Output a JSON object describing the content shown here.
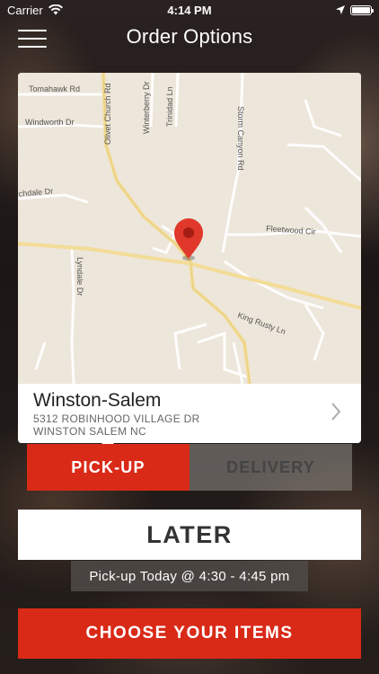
{
  "status_bar": {
    "carrier": "Carrier",
    "time": "4:14 PM",
    "battery_level": 1.0,
    "icons": [
      "wifi-icon",
      "location-arrow-icon",
      "battery-icon"
    ]
  },
  "nav": {
    "title": "Order Options",
    "menu_icon": "hamburger-menu-icon"
  },
  "map": {
    "roads": [
      "Tomahawk Rd",
      "Windworth Dr",
      "Olivet Church Rd",
      "Winterberry Dr",
      "Trinidad Ln",
      "Storm Canyon Rd",
      "rchdale Dr",
      "Fleetwood Cir",
      "Lyndale Dr",
      "King Rusty Ln"
    ],
    "pin_icon": "map-pin-icon"
  },
  "location": {
    "name": "Winston-Salem",
    "address_line1": "5312 ROBINHOOD VILLAGE DR",
    "address_line2": "WINSTON SALEM NC"
  },
  "tabs": {
    "pickup": "PICK-UP",
    "delivery": "DELIVERY",
    "selected": "pickup"
  },
  "later_label": "LATER",
  "pickup_time": "Pick-up Today @ 4:30 - 4:45 pm",
  "choose_label": "CHOOSE YOUR ITEMS",
  "colors": {
    "accent": "#d92a18",
    "map_bg": "#ede6da",
    "major_road": "#f3dc97"
  }
}
